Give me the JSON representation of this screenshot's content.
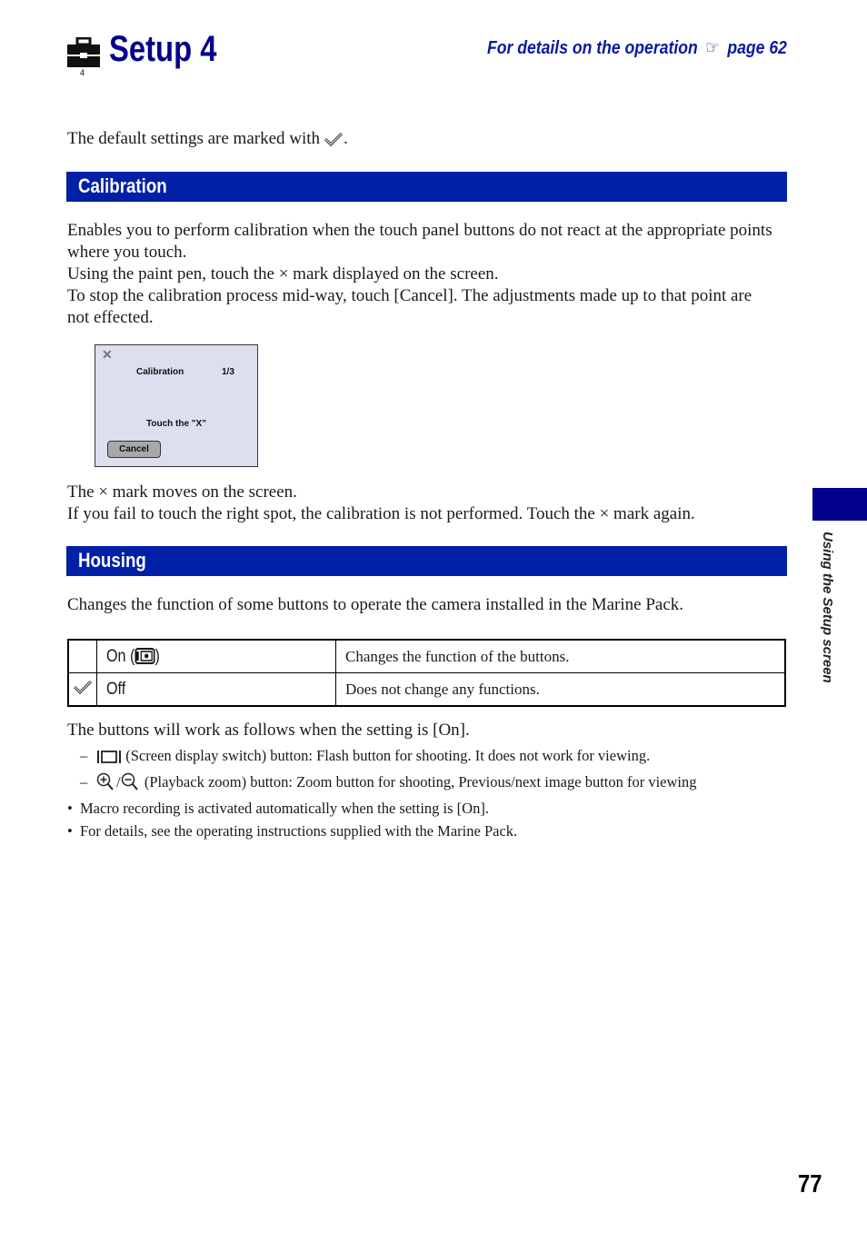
{
  "header": {
    "title": "Setup 4",
    "title_icon": "toolbox-icon",
    "title_icon_number": "4",
    "operation_ref_text": "For details on the operation",
    "operation_ref_symbol": "☞",
    "operation_ref_page": "page 62"
  },
  "default_note": {
    "text": "The default settings are marked with",
    "icon": "checkmark-icon",
    "suffix": "."
  },
  "sections": {
    "calibration": {
      "title": "Calibration",
      "paragraphs": [
        "Enables you to perform calibration when the touch panel buttons do not react at the appropriate points where you touch.",
        "Using the paint pen, touch the × mark displayed on the screen.",
        "To stop the calibration process mid-way, touch [Cancel]. The adjustments made up to that point are not effected."
      ],
      "screen": {
        "close_glyph": "✕",
        "title": "Calibration",
        "step": "1/3",
        "instruction": "Touch the \"X\"",
        "cancel_label": "Cancel"
      },
      "after_paragraphs": [
        "The × mark moves on the screen.",
        "If you fail to touch the right spot, the calibration is not performed. Touch the × mark again."
      ]
    },
    "housing": {
      "title": "Housing",
      "description": "Changes the function of some buttons to operate the camera installed in the Marine Pack.",
      "options": [
        {
          "label": "On (",
          "label_suffix": ")",
          "icon": "marine-pack-icon",
          "description": "Changes the function of the buttons.",
          "default": false
        },
        {
          "label": "Off",
          "label_suffix": "",
          "icon": "",
          "description": "Does not change any functions.",
          "default": true
        }
      ],
      "after_table": "The buttons will work as follows when the setting is [On].",
      "dash_items": [
        {
          "icon": "screen-display-switch-icon",
          "text": "(Screen display switch) button: Flash button for shooting. It does not work for viewing."
        },
        {
          "icon": "playback-zoom-icon",
          "separator": "/",
          "text": "(Playback zoom) button: Zoom button for shooting, Previous/next image button for viewing"
        }
      ],
      "bullets": [
        "Macro recording is activated automatically when the setting is [On].",
        "For details, see the operating instructions supplied with the Marine Pack."
      ]
    }
  },
  "side_tab": {
    "label": "Using the Setup screen",
    "color": "#00008c"
  },
  "page_number": "77",
  "colors": {
    "title": "#00008c",
    "section_bar": "#0020a8",
    "reference_link": "#0a1aa0"
  }
}
